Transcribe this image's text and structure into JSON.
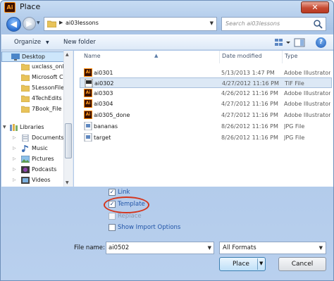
{
  "window": {
    "title": "Place",
    "app_icon_text": "Ai",
    "close_symbol": "✕"
  },
  "address": {
    "path": "ai03lessons",
    "search_placeholder": "Search ai03lessons"
  },
  "toolbar": {
    "organize_label": "Organize",
    "new_folder_label": "New folder",
    "help_symbol": "?"
  },
  "nav": {
    "items": [
      {
        "label": "Desktop",
        "icon": "desktop-icon"
      },
      {
        "label": "uxclass_onl",
        "icon": "folder-icon"
      },
      {
        "label": "Microsoft C",
        "icon": "folder-icon"
      },
      {
        "label": "5LessonFile",
        "icon": "folder-icon"
      },
      {
        "label": "4TechEdits",
        "icon": "folder-icon"
      },
      {
        "label": "7Book_File",
        "icon": "folder-icon"
      },
      {
        "label": "Libraries",
        "icon": "libraries-icon"
      },
      {
        "label": "Documents",
        "icon": "documents-icon"
      },
      {
        "label": "Music",
        "icon": "music-icon"
      },
      {
        "label": "Pictures",
        "icon": "pictures-icon"
      },
      {
        "label": "Podcasts",
        "icon": "podcasts-icon"
      },
      {
        "label": "Videos",
        "icon": "videos-icon"
      }
    ]
  },
  "files": {
    "headers": {
      "name": "Name",
      "date": "Date modified",
      "type": "Type"
    },
    "rows": [
      {
        "name": "ai0301",
        "date": "5/13/2013 1:47 PM",
        "type": "Adobe Illustrator",
        "icon": "ai-file-icon"
      },
      {
        "name": "ai0302",
        "date": "4/27/2012 11:16 PM",
        "type": "TIF File",
        "icon": "tif-file-icon"
      },
      {
        "name": "ai0303",
        "date": "4/26/2012 11:16 PM",
        "type": "Adobe Illustrator",
        "icon": "ai-file-icon"
      },
      {
        "name": "ai0304",
        "date": "4/27/2012 11:16 PM",
        "type": "Adobe Illustrator",
        "icon": "ai-file-icon"
      },
      {
        "name": "ai0305_done",
        "date": "4/27/2012 11:16 PM",
        "type": "Adobe Illustrator",
        "icon": "ai-file-icon"
      },
      {
        "name": "bananas",
        "date": "8/26/2012 11:16 PM",
        "type": "JPG File",
        "icon": "jpg-file-icon"
      },
      {
        "name": "target",
        "date": "8/26/2012 11:16 PM",
        "type": "JPG File",
        "icon": "jpg-file-icon"
      }
    ]
  },
  "options": {
    "link": {
      "label": "Link",
      "checked": true
    },
    "template": {
      "label": "Template",
      "checked": true
    },
    "replace": {
      "label": "Replace",
      "checked": false
    },
    "show_import": {
      "label": "Show Import Options",
      "checked": false
    }
  },
  "footer": {
    "filename_label": "File name:",
    "filename_value": "ai0502",
    "format_value": "All Formats",
    "place_label": "Place",
    "cancel_label": "Cancel"
  },
  "colors": {
    "accent": "#2356a8",
    "highlight_circle": "#d4351c",
    "selection": "#cde6fb"
  }
}
